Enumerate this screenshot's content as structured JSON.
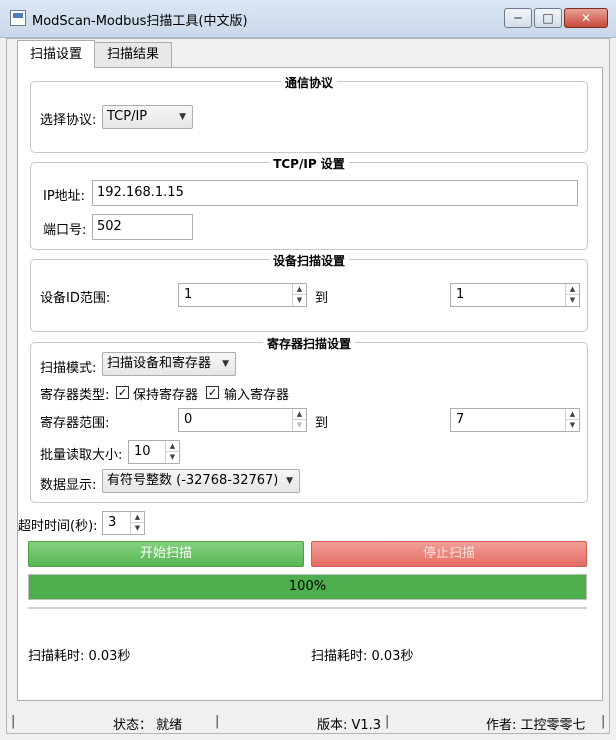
{
  "window": {
    "title": "ModScan-Modbus扫描工具(中文版)"
  },
  "tabs": [
    {
      "label": "扫描设置"
    },
    {
      "label": "扫描结果"
    }
  ],
  "protocol_group": {
    "title": "通信协议",
    "label": "选择协议:",
    "selected": "TCP/IP"
  },
  "tcp_group": {
    "title": "TCP/IP 设置",
    "ip_label": "IP地址:",
    "ip_value": "192.168.1.15",
    "port_label": "端口号:",
    "port_value": "502"
  },
  "device_group": {
    "title": "设备扫描设置",
    "id_label": "设备ID范围:",
    "id_from": "1",
    "to_label": "到",
    "id_to": "1"
  },
  "register_group": {
    "title": "寄存器扫描设置",
    "mode_label": "扫描模式:",
    "mode_value": "扫描设备和寄存器",
    "type_label": "寄存器类型:",
    "holding_label": "保持寄存器",
    "input_label": "输入寄存器",
    "check_mark": "✓",
    "range_label": "寄存器范围:",
    "range_from": "0",
    "to_label": "到",
    "range_to": "7",
    "batch_label": "批量读取大小:",
    "batch_value": "10",
    "display_label": "数据显示:",
    "display_value": "有符号整数 (-32768-32767)"
  },
  "timeout": {
    "label": "超时时间(秒):",
    "value": "3"
  },
  "actions": {
    "start_label": "开始扫描",
    "stop_label": "停止扫描"
  },
  "progress": {
    "percent": 100,
    "text": "100%"
  },
  "timing": {
    "left": "扫描耗时: 0.03秒",
    "right": "扫描耗时: 0.03秒"
  },
  "status_bar": {
    "state": "状态： 就绪",
    "version": "版本: V1.3",
    "author": "作者: 工控零零七",
    "separator": "|"
  },
  "icons": {
    "minimize": "─",
    "maximize": "□",
    "close": "✕",
    "dropdown": "▼",
    "spin_up": "▲",
    "spin_down": "▼"
  },
  "colors": {
    "start": "#5cb85c",
    "stop": "#e8756b",
    "progress": "#4cae4c"
  }
}
